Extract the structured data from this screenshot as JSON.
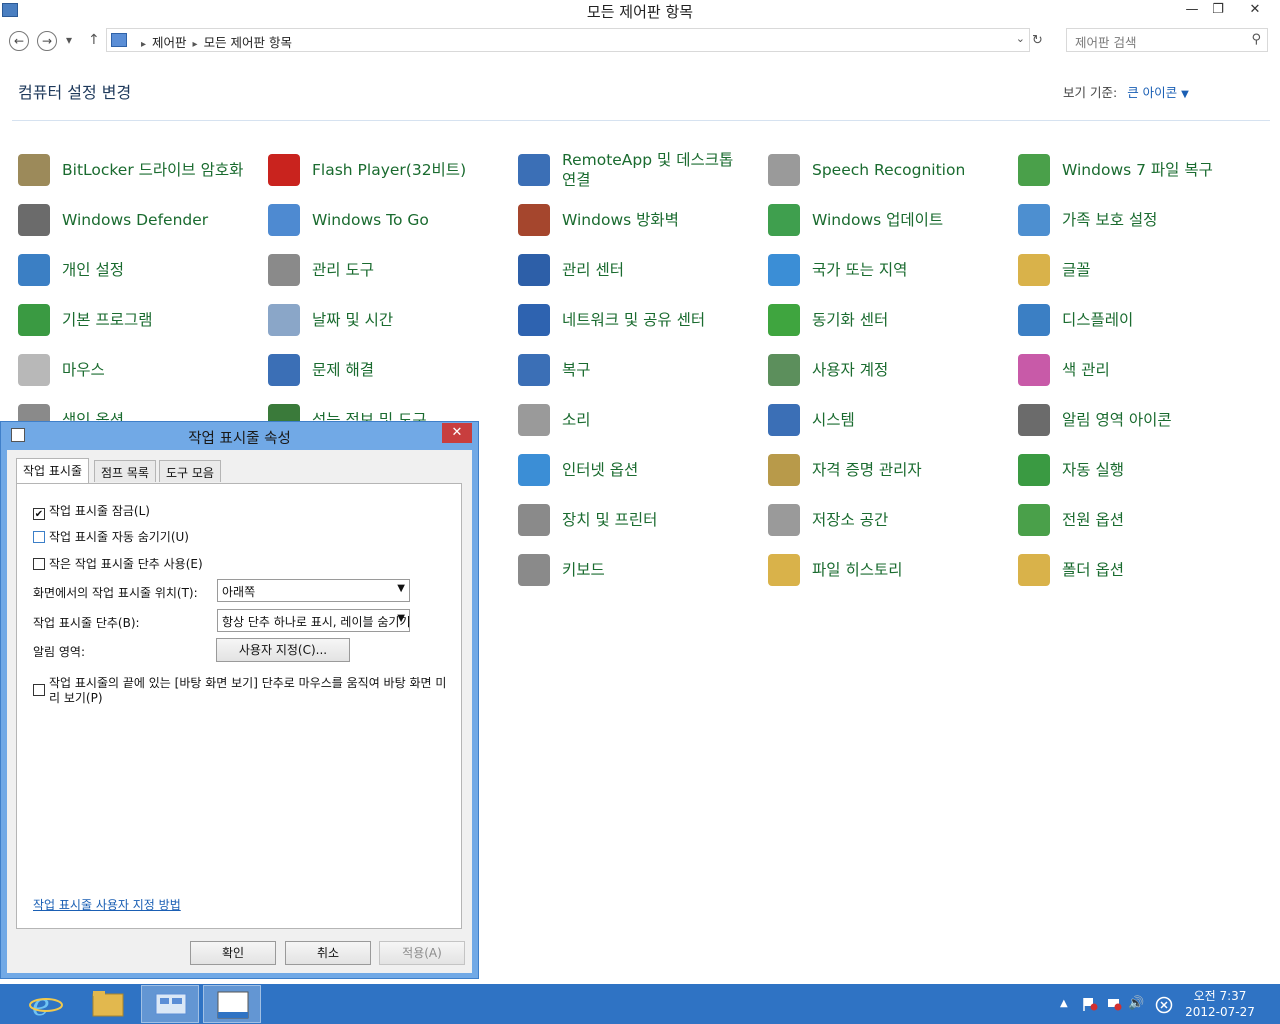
{
  "window": {
    "title": "모든 제어판 항목",
    "min": "—",
    "max": "❐",
    "close": "✕"
  },
  "nav": {
    "back": "←",
    "forward": "→",
    "recent": "▾",
    "up": "↑",
    "crumbs": [
      "제어판",
      "모든 제어판 항목"
    ],
    "sep": "▸",
    "dropdown": "⌄",
    "refresh": "↻",
    "search_placeholder": "제어판 검색",
    "search_icon": "⚲"
  },
  "header": {
    "title": "컴퓨터 설정 변경",
    "viewby_label": "보기 기준:",
    "viewby_value": "큰 아이콘",
    "caret": "▼"
  },
  "items": [
    {
      "label": "BitLocker 드라이브 암호화",
      "icon": "bitlocker-icon",
      "color": "#9c8a5a"
    },
    {
      "label": "Flash Player(32비트)",
      "icon": "flash-player-icon",
      "color": "#c9231e"
    },
    {
      "label": "RemoteApp 및 데스크톱 연결",
      "icon": "remoteapp-icon",
      "color": "#3b6fb6"
    },
    {
      "label": "Speech Recognition",
      "icon": "microphone-icon",
      "color": "#9a9a9a"
    },
    {
      "label": "Windows 7 파일 복구",
      "icon": "file-recovery-icon",
      "color": "#4aa04a"
    },
    {
      "label": "Windows Defender",
      "icon": "defender-icon",
      "color": "#6b6b6b"
    },
    {
      "label": "Windows To Go",
      "icon": "windows-to-go-icon",
      "color": "#4e8ad1"
    },
    {
      "label": "Windows 방화벽",
      "icon": "firewall-icon",
      "color": "#a5462d"
    },
    {
      "label": "Windows 업데이트",
      "icon": "windows-update-icon",
      "color": "#3f9f4e"
    },
    {
      "label": "가족 보호 설정",
      "icon": "family-safety-icon",
      "color": "#4d8fd0"
    },
    {
      "label": "개인 설정",
      "icon": "personalization-icon",
      "color": "#3b7fc4"
    },
    {
      "label": "관리 도구",
      "icon": "admin-tools-icon",
      "color": "#8a8a8a"
    },
    {
      "label": "관리 센터",
      "icon": "action-center-icon",
      "color": "#2d5fa8"
    },
    {
      "label": "국가 또는 지역",
      "icon": "region-icon",
      "color": "#3b8ed6"
    },
    {
      "label": "글꼴",
      "icon": "fonts-icon",
      "color": "#d9b24a"
    },
    {
      "label": "기본 프로그램",
      "icon": "default-programs-icon",
      "color": "#3a9a42"
    },
    {
      "label": "날짜 및 시간",
      "icon": "date-time-icon",
      "color": "#8aa6c8"
    },
    {
      "label": "네트워크 및 공유 센터",
      "icon": "network-icon",
      "color": "#2e63b0"
    },
    {
      "label": "동기화 센터",
      "icon": "sync-center-icon",
      "color": "#3fa53f"
    },
    {
      "label": "디스플레이",
      "icon": "display-icon",
      "color": "#3b7fc4"
    },
    {
      "label": "마우스",
      "icon": "mouse-icon",
      "color": "#b8b8b8"
    },
    {
      "label": "문제 해결",
      "icon": "troubleshooting-icon",
      "color": "#3b6fb6"
    },
    {
      "label": "복구",
      "icon": "recovery-icon",
      "color": "#3b6fb6"
    },
    {
      "label": "사용자 계정",
      "icon": "user-accounts-icon",
      "color": "#5c8f5c"
    },
    {
      "label": "색 관리",
      "icon": "color-management-icon",
      "color": "#c85aa8"
    },
    {
      "label": "색인 옵션",
      "icon": "indexing-icon",
      "color": "#8a8a8a"
    },
    {
      "label": "성능 정보 및 도구",
      "icon": "performance-icon",
      "color": "#3a7a3a"
    },
    {
      "label": "소리",
      "icon": "sound-icon",
      "color": "#9a9a9a"
    },
    {
      "label": "시스템",
      "icon": "system-icon",
      "color": "#3b6fb6"
    },
    {
      "label": "알림 영역 아이콘",
      "icon": "notification-area-icon",
      "color": "#6b6b6b"
    },
    {
      "label": "",
      "icon": "",
      "color": ""
    },
    {
      "label": "",
      "icon": "",
      "color": ""
    },
    {
      "label": "인터넷 옵션",
      "icon": "internet-options-icon",
      "color": "#3b8ed6"
    },
    {
      "label": "자격 증명 관리자",
      "icon": "credential-manager-icon",
      "color": "#b89a4a"
    },
    {
      "label": "자동 실행",
      "icon": "autoplay-icon",
      "color": "#3a9a42"
    },
    {
      "label": "",
      "icon": "",
      "color": ""
    },
    {
      "label": "",
      "icon": "",
      "color": ""
    },
    {
      "label": "장치 및 프린터",
      "icon": "devices-printers-icon",
      "color": "#8a8a8a"
    },
    {
      "label": "저장소 공간",
      "icon": "storage-spaces-icon",
      "color": "#9a9a9a"
    },
    {
      "label": "전원 옵션",
      "icon": "power-options-icon",
      "color": "#4aa04a"
    },
    {
      "label": "",
      "icon": "",
      "color": ""
    },
    {
      "label": "",
      "icon": "",
      "color": ""
    },
    {
      "label": "키보드",
      "icon": "keyboard-icon",
      "color": "#8a8a8a"
    },
    {
      "label": "파일 히스토리",
      "icon": "file-history-icon",
      "color": "#d9b24a"
    },
    {
      "label": "폴더 옵션",
      "icon": "folder-options-icon",
      "color": "#d9b24a"
    }
  ],
  "dialog": {
    "title": "작업 표시줄 속성",
    "close": "✕",
    "tabs": [
      "작업 표시줄",
      "점프 목록",
      "도구 모음"
    ],
    "lock": "작업 표시줄 잠금(L)",
    "autohide": "작업 표시줄 자동 숨기기(U)",
    "small": "작은 작업 표시줄 단추 사용(E)",
    "position_label": "화면에서의 작업 표시줄 위치(T):",
    "position_value": "아래쪽",
    "buttons_label": "작업 표시줄 단추(B):",
    "buttons_value": "항상 단추 하나로 표시, 레이블 숨기기",
    "notify_label": "알림 영역:",
    "customize": "사용자 지정(C)...",
    "peek": "작업 표시줄의 끝에 있는 [바탕 화면 보기] 단추로 마우스를 움직여 바탕 화면 미리 보기(P)",
    "help_link": "작업 표시줄 사용자 지정 방법",
    "ok": "확인",
    "cancel": "취소",
    "apply": "적용(A)",
    "check_mark": "✔",
    "arrow": "▼"
  },
  "taskbar": {
    "apps": [
      "internet-explorer-icon",
      "file-explorer-icon",
      "control-panel-icon",
      "taskbar-properties-icon"
    ],
    "tray_up": "▲",
    "volume": "🔊",
    "time": "오전 7:37",
    "date": "2012-07-27"
  }
}
